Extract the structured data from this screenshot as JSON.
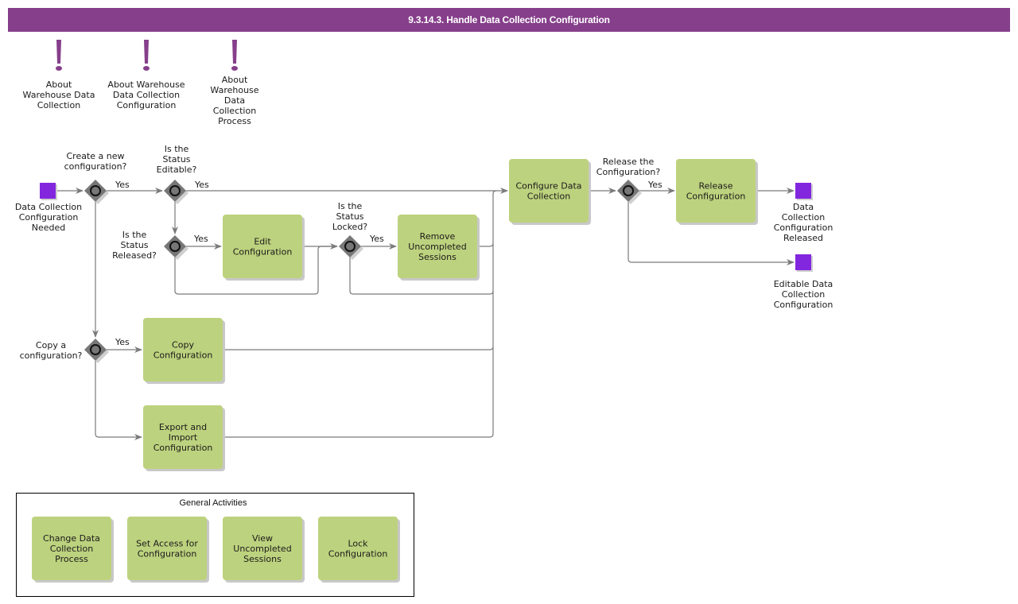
{
  "header": {
    "title": "9.3.14.3. Handle Data Collection Configuration"
  },
  "colors": {
    "header": "#863f8b",
    "task": "#bdd27e",
    "event": "#8227dd",
    "gateway": "#777777",
    "flow": "#7a7a7a"
  },
  "notes": [
    {
      "icon": "exclamation-icon",
      "lines": [
        "About",
        "Warehouse Data",
        "Collection"
      ]
    },
    {
      "icon": "exclamation-icon",
      "lines": [
        "About Warehouse",
        "Data Collection",
        "Configuration"
      ]
    },
    {
      "icon": "exclamation-icon",
      "lines": [
        "About",
        "Warehouse",
        "Data",
        "Collection",
        "Process"
      ]
    }
  ],
  "events": {
    "start": {
      "lines": [
        "Data Collection",
        "Configuration",
        "Needed"
      ]
    },
    "end_released": {
      "lines": [
        "Data",
        "Collection",
        "Configuration",
        "Released"
      ]
    },
    "end_editable": {
      "lines": [
        "Editable Data",
        "Collection",
        "Configuration"
      ]
    }
  },
  "gateways": {
    "create_new": {
      "lines": [
        "Create a new",
        "configuration?"
      ]
    },
    "status_editable": {
      "lines": [
        "Is the",
        "Status",
        "Editable?"
      ]
    },
    "status_released": {
      "lines": [
        "Is the",
        "Status",
        "Released?"
      ]
    },
    "status_locked": {
      "lines": [
        "Is the",
        "Status",
        "Locked?"
      ]
    },
    "copy": {
      "lines": [
        "Copy a",
        "configuration?"
      ]
    },
    "release": {
      "lines": [
        "Release the",
        "Configuration?"
      ]
    }
  },
  "flow_labels": {
    "yes": "Yes"
  },
  "tasks": {
    "edit": {
      "lines": [
        "Edit",
        "Configuration"
      ]
    },
    "remove_sessions": {
      "lines": [
        "Remove",
        "Uncompleted",
        "Sessions"
      ]
    },
    "configure": {
      "lines": [
        "Configure Data",
        "Collection"
      ]
    },
    "release": {
      "lines": [
        "Release",
        "Configuration"
      ]
    },
    "copy": {
      "lines": [
        "Copy",
        "Configuration"
      ]
    },
    "export_import": {
      "lines": [
        "Export and",
        "Import",
        "Configuration"
      ]
    }
  },
  "general_activities": {
    "title": "General Activities",
    "items": [
      {
        "lines": [
          "Change Data",
          "Collection",
          "Process"
        ]
      },
      {
        "lines": [
          "Set Access for",
          "Configuration"
        ]
      },
      {
        "lines": [
          "View",
          "Uncompleted",
          "Sessions"
        ]
      },
      {
        "lines": [
          "Lock",
          "Configuration"
        ]
      }
    ]
  }
}
